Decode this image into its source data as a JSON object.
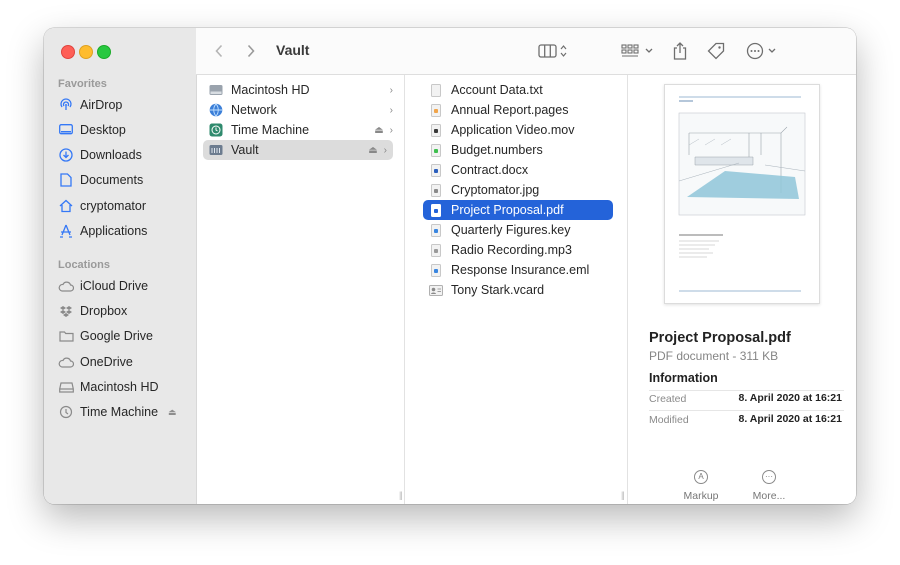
{
  "window_title": "Vault",
  "sidebar": {
    "favorites_heading": "Favorites",
    "favorites": [
      {
        "label": "AirDrop",
        "icon": "airdrop-icon"
      },
      {
        "label": "Desktop",
        "icon": "desktop-icon"
      },
      {
        "label": "Downloads",
        "icon": "downloads-icon"
      },
      {
        "label": "Documents",
        "icon": "documents-icon"
      },
      {
        "label": "cryptomator",
        "icon": "home-icon"
      },
      {
        "label": "Applications",
        "icon": "applications-icon"
      }
    ],
    "locations_heading": "Locations",
    "locations": [
      {
        "label": "iCloud Drive",
        "icon": "cloud-icon"
      },
      {
        "label": "Dropbox",
        "icon": "dropbox-icon"
      },
      {
        "label": "Google Drive",
        "icon": "folder-icon"
      },
      {
        "label": "OneDrive",
        "icon": "cloud-icon"
      },
      {
        "label": "Macintosh HD",
        "icon": "disk-icon"
      },
      {
        "label": "Time Machine",
        "icon": "time-machine-icon"
      }
    ]
  },
  "column1": [
    {
      "label": "Macintosh HD",
      "icon": "hard-drive-icon",
      "eject": false
    },
    {
      "label": "Network",
      "icon": "network-globe-icon",
      "eject": false
    },
    {
      "label": "Time Machine",
      "icon": "time-machine-icon",
      "eject": true
    },
    {
      "label": "Vault",
      "icon": "vault-drive-icon",
      "eject": true
    }
  ],
  "column2": [
    {
      "label": "Account Data.txt",
      "color": "#bdbdbd"
    },
    {
      "label": "Annual Report.pages",
      "color": "#f0a44a"
    },
    {
      "label": "Application Video.mov",
      "color": "#3a3a3a"
    },
    {
      "label": "Budget.numbers",
      "color": "#3fbf4f"
    },
    {
      "label": "Contract.docx",
      "color": "#2b5fbd"
    },
    {
      "label": "Cryptomator.jpg",
      "color": "#8a8a8a"
    },
    {
      "label": "Project Proposal.pdf",
      "color": "#ffffff"
    },
    {
      "label": "Quarterly Figures.key",
      "color": "#3a86e0"
    },
    {
      "label": "Radio Recording.mp3",
      "color": "#9a9a9a"
    },
    {
      "label": "Response Insurance.eml",
      "color": "#3a86e0"
    },
    {
      "label": "Tony Stark.vcard",
      "color": "#8a8a8a"
    }
  ],
  "preview": {
    "file_name": "Project Proposal.pdf",
    "kind_size": "PDF document - 311 KB",
    "info_heading": "Information",
    "created_label": "Created",
    "created_value": "8. April 2020 at 16:21",
    "modified_label": "Modified",
    "modified_value": "8. April 2020 at 16:21",
    "markup_label": "Markup",
    "more_label": "More..."
  },
  "colors": {
    "selection_blue": "#2463d9",
    "sidebar_icon": "#3478f6"
  }
}
